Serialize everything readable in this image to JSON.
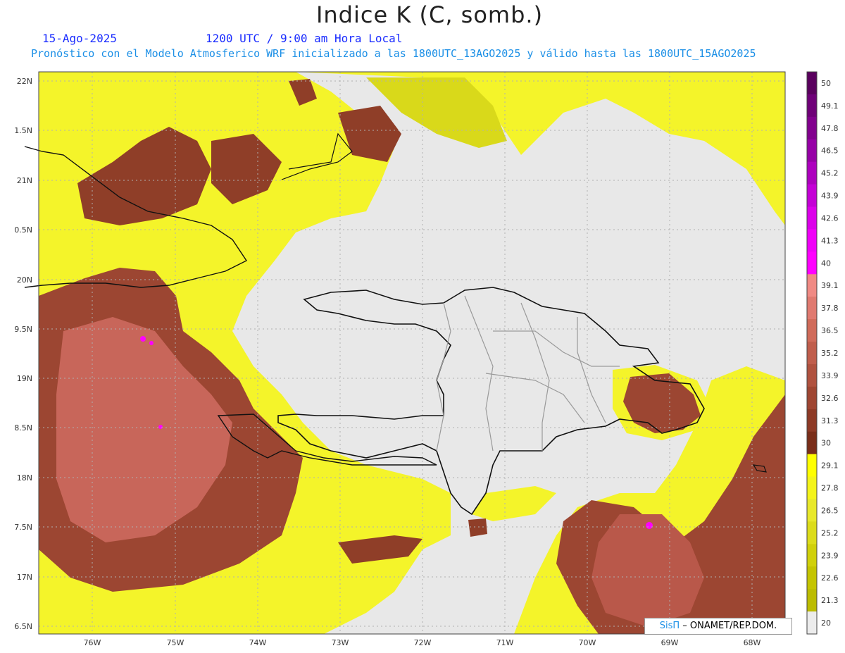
{
  "title": "Indice K (C, somb.)",
  "date_label": "15-Ago-2025",
  "time_label": "1200 UTC / 9:00 am Hora Local",
  "forecast_label": "Pronóstico con el Modelo Atmosferico WRF inicializado a las 1800UTC_13AGO2025 y válido hasta las  1800UTC_15AGO2025",
  "credit": {
    "brand": "SisΠ",
    "org": " – ONAMET/REP.DOM."
  },
  "lat_labels": [
    "22N",
    "1.5N",
    "21N",
    "0.5N",
    "20N",
    "9.5N",
    "19N",
    "8.5N",
    "18N",
    "7.5N",
    "17N",
    "6.5N"
  ],
  "lon_labels": [
    "76W",
    "75W",
    "74W",
    "73W",
    "72W",
    "71W",
    "70W",
    "69W",
    "68W"
  ],
  "colorbar_labels": [
    "50",
    "49.1",
    "47.8",
    "46.5",
    "45.2",
    "43.9",
    "42.6",
    "41.3",
    "40",
    "39.1",
    "37.8",
    "36.5",
    "35.2",
    "33.9",
    "32.6",
    "31.3",
    "30",
    "29.1",
    "27.8",
    "26.5",
    "25.2",
    "23.9",
    "22.6",
    "21.3",
    "20"
  ],
  "colors": {
    "background": "#e8e8e8",
    "yellow_light": "#ffff33",
    "yellow_dark": "#c8c800",
    "brown_dark": "#8a3a20",
    "brown_mid": "#b15a45",
    "brown_light": "#d06b5a",
    "magenta": "#ff00ff",
    "purple": "#6a0070",
    "coast": "#111111",
    "borders": "#9a9a9a",
    "grid": "#b0b0b0"
  }
}
